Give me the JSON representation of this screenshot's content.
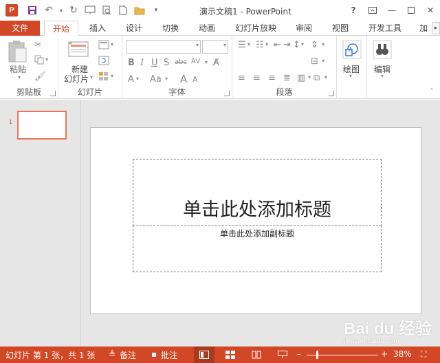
{
  "window": {
    "title": "演示文稿1 - PowerPoint",
    "app_icon_letter": "P",
    "help": "?",
    "controls": [
      "ribbon-display-icon",
      "minimize-icon",
      "restore-icon",
      "close-icon"
    ]
  },
  "colors": {
    "accent": "#d24726",
    "thumb_border": "#e8765b",
    "workspace": "#e6e6e6"
  },
  "tabs": [
    {
      "label": "文件"
    },
    {
      "label": "开始"
    },
    {
      "label": "插入"
    },
    {
      "label": "设计"
    },
    {
      "label": "切换"
    },
    {
      "label": "动画"
    },
    {
      "label": "幻灯片放映"
    },
    {
      "label": "审阅"
    },
    {
      "label": "视图"
    },
    {
      "label": "开发工具"
    },
    {
      "label": "加"
    }
  ],
  "ribbon": {
    "clipboard": {
      "label": "剪贴板",
      "paste": "粘贴"
    },
    "slides": {
      "label": "幻灯片",
      "new_slide_line1": "新建",
      "new_slide_line2": "幻灯片"
    },
    "font": {
      "label": "字体",
      "font_name": "",
      "font_size": ""
    },
    "paragraph": {
      "label": "段落"
    },
    "drawing": {
      "label": "绘图"
    },
    "editing": {
      "label": "编辑"
    }
  },
  "thumbnails": [
    {
      "number": "1"
    }
  ],
  "slide": {
    "title_placeholder": "单击此处添加标题",
    "subtitle_placeholder": "单击此处添加副标题"
  },
  "status": {
    "slide_info": "幻灯片 第 1 张，共 1 张",
    "notes": "备注",
    "comments": "批注",
    "zoom": "38%"
  },
  "watermark": {
    "text": "Bai du 经验",
    "url": "jingyan.baidu.com"
  }
}
